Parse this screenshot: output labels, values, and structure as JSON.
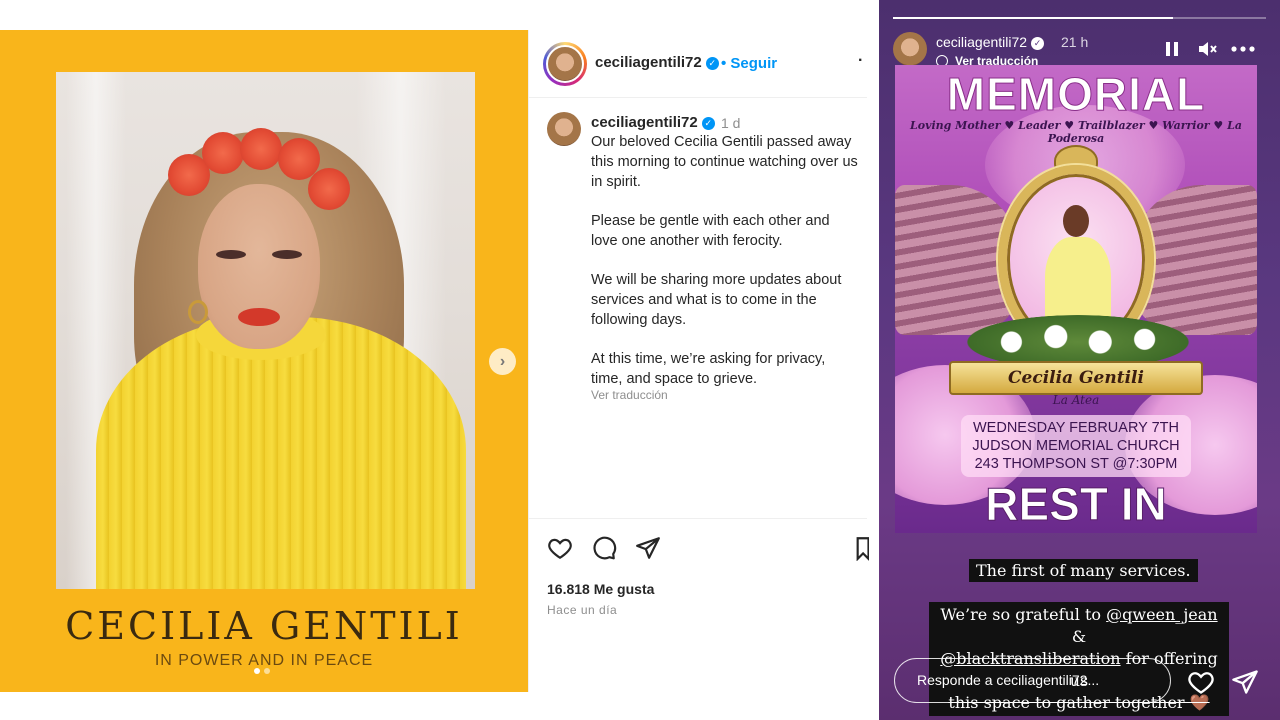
{
  "post": {
    "media": {
      "name_text": "CECILIA GENTILI",
      "subtitle": "IN POWER AND IN PEACE"
    },
    "header": {
      "username": "ceciliagentili72",
      "follow_label": "• Seguir",
      "more_label": "·"
    },
    "caption": {
      "username": "ceciliagentili72",
      "time": "1 d",
      "paragraphs": [
        "Our beloved Cecilia Gentili passed away this morning to continue watching over us in spirit.",
        "Please be gentle with each other and love one another with ferocity.",
        "We will be sharing more updates about services and what is to come in the following days.",
        "At this time, we’re asking for privacy, time, and space to grieve."
      ],
      "see_translation": "Ver traducción"
    },
    "likes": "16.818 Me gusta",
    "ago": "Hace un día",
    "icons": [
      "heart-icon",
      "comment-icon",
      "share-icon",
      "bookmark-icon"
    ]
  },
  "story": {
    "progress": 0.75,
    "username": "ceciliagentili72",
    "time": "21 h",
    "see_translation": "Ver traducción",
    "flyer": {
      "title": "MEMORIAL",
      "tags": "Loving Mother ♥ Leader ♥ Trailblazer ♥ Warrior ♥ La Poderosa",
      "banner_name": "Cecilia Gentili",
      "aka": "La Atea",
      "event_lines": [
        "WEDNESDAY FEBRUARY 7TH",
        "JUDSON MEMORIAL CHURCH",
        "243 THOMPSON ST @7:30PM"
      ],
      "footer": "REST IN POWER"
    },
    "label1": "The first of many services.",
    "label2": {
      "prefix": "We’re so grateful to ",
      "mention1": "@qween_jean",
      "amp": " &",
      "mention2": "@blacktransliberation",
      "suffix": " for offering us",
      "line3": "this space to gather together 🤎"
    },
    "reply_placeholder": "Responde a ceciliagentili72..."
  }
}
